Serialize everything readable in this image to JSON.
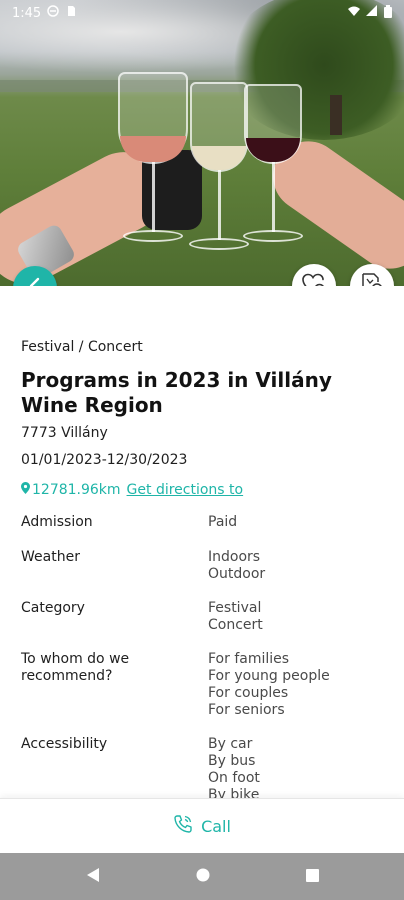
{
  "status_bar": {
    "time": "1:45"
  },
  "detail": {
    "category": "Festival / Concert",
    "title": "Programs in 2023 in Villány Wine Region",
    "address": "7773 Villány",
    "dates": "01/01/2023-12/30/2023",
    "distance": "12781.96km",
    "directions_label": "Get directions to"
  },
  "attributes": [
    {
      "label": "Admission",
      "values": [
        "Paid"
      ]
    },
    {
      "label": "Weather",
      "values": [
        "Indoors",
        "Outdoor"
      ]
    },
    {
      "label": "Category",
      "values": [
        "Festival",
        "Concert"
      ]
    },
    {
      "label": "To whom do we recommend?",
      "values": [
        "For families",
        "For young people",
        "For couples",
        "For seniors"
      ]
    },
    {
      "label": "Accessibility",
      "values": [
        "By car",
        "By bus",
        "On foot",
        "By bike"
      ]
    }
  ],
  "call_bar": {
    "label": "Call"
  },
  "colors": {
    "accent": "#1fb5a8",
    "nav_bar": "#9b9b9b"
  },
  "icons": {
    "back": "chevron-left-icon",
    "favorite": "heart-plus-icon",
    "route": "route-plan-icon",
    "location": "location-pin-icon",
    "call": "phone-icon"
  }
}
